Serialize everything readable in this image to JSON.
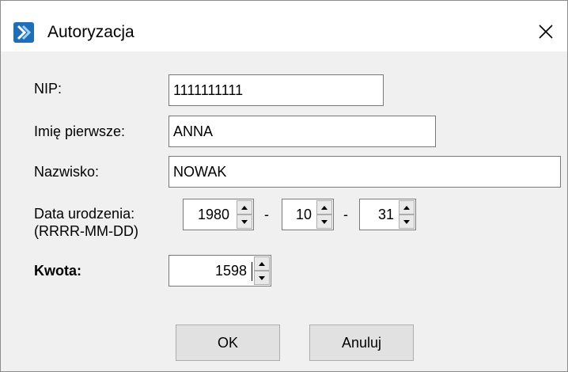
{
  "window": {
    "title": "Autoryzacja"
  },
  "fields": {
    "nip": {
      "label": "NIP:",
      "value": "1111111111"
    },
    "first_name": {
      "label": "Imię pierwsze:",
      "value": "ANNA"
    },
    "last_name": {
      "label": "Nazwisko:",
      "value": "NOWAK"
    },
    "birth_date": {
      "label": "Data urodzenia:",
      "format_hint": "(RRRR-MM-DD)",
      "year": "1980",
      "month": "10",
      "day": "31",
      "separator": "-"
    },
    "amount": {
      "label": "Kwota:",
      "value": "1598"
    }
  },
  "buttons": {
    "ok": "OK",
    "cancel": "Anuluj"
  },
  "colors": {
    "dialog_bg": "#f0f0f0",
    "titlebar_bg": "#ffffff",
    "app_icon": "#1e6fb8",
    "button_bg": "#e1e1e1"
  }
}
